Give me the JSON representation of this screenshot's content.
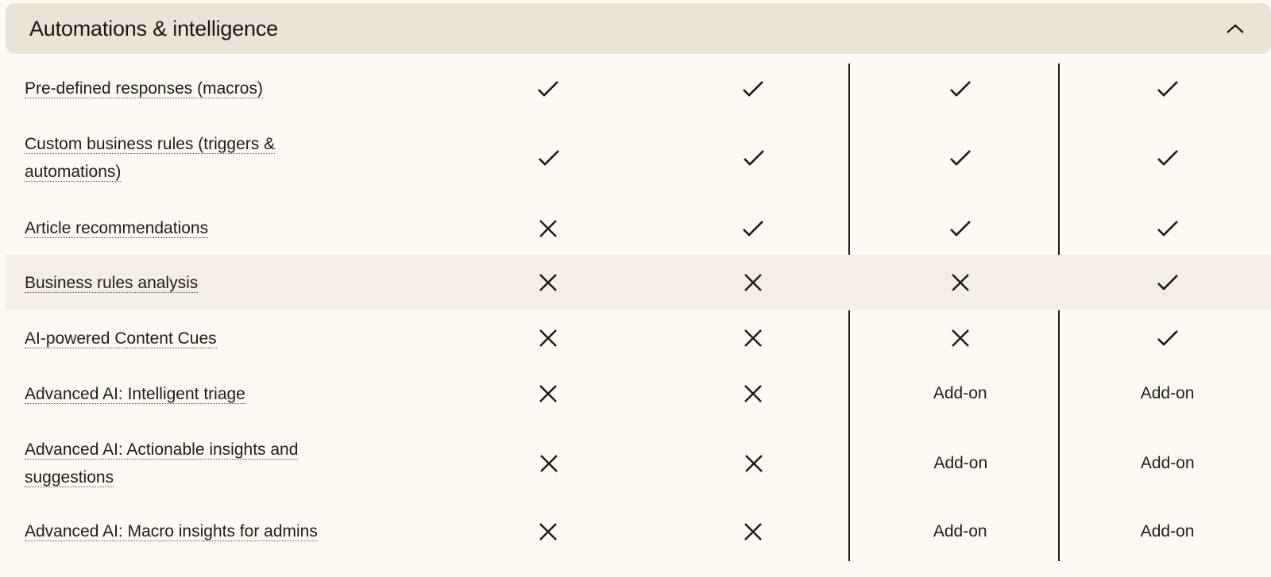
{
  "section": {
    "title": "Automations & intelligence",
    "expanded": true,
    "toggle_icon": "chevron-up-icon"
  },
  "colors": {
    "background": "#fdf9f3",
    "header_background": "#ebe3d6",
    "highlight_row": "#f5eee4",
    "text": "#1f1d1a"
  },
  "rows": [
    {
      "feature": "Pre-defined responses (macros)",
      "values": [
        "check",
        "check",
        "check",
        "check"
      ]
    },
    {
      "feature": "Custom business rules (triggers & automations)",
      "values": [
        "check",
        "check",
        "check",
        "check"
      ]
    },
    {
      "feature": "Article recommendations",
      "values": [
        "cross",
        "check",
        "check",
        "check"
      ]
    },
    {
      "feature": "Business rules analysis",
      "values": [
        "cross",
        "cross",
        "cross",
        "check"
      ],
      "highlighted": true
    },
    {
      "feature": "AI-powered Content Cues",
      "values": [
        "cross",
        "cross",
        "cross",
        "check"
      ]
    },
    {
      "feature": "Advanced AI: Intelligent triage",
      "values": [
        "cross",
        "cross",
        "Add-on",
        "Add-on"
      ]
    },
    {
      "feature": "Advanced AI: Actionable insights and suggestions",
      "values": [
        "cross",
        "cross",
        "Add-on",
        "Add-on"
      ]
    },
    {
      "feature": "Advanced AI: Macro insights for admins",
      "values": [
        "cross",
        "cross",
        "Add-on",
        "Add-on"
      ]
    }
  ]
}
